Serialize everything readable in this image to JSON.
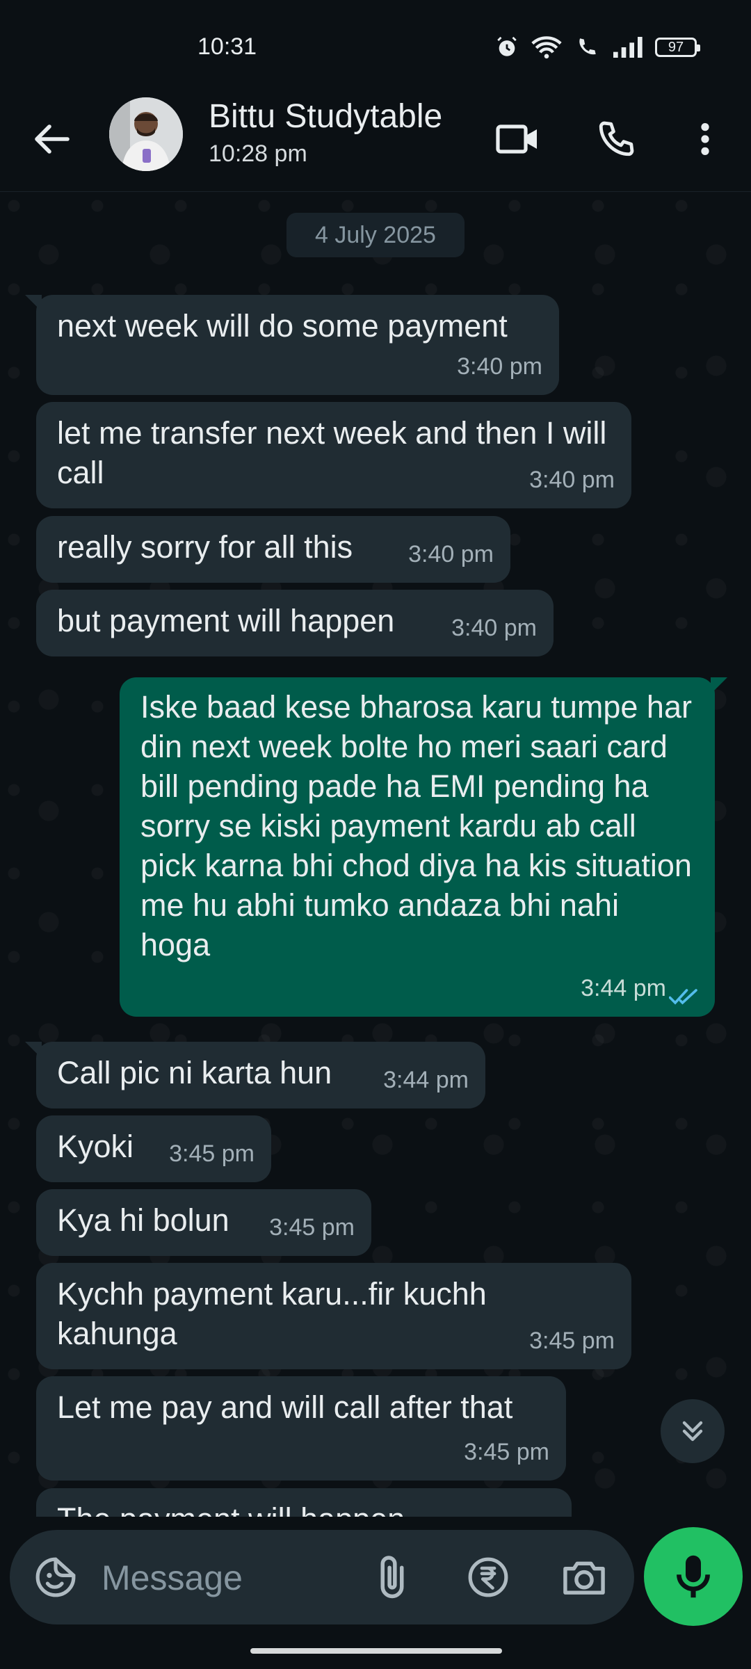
{
  "status_bar": {
    "time": "10:31",
    "battery": "97"
  },
  "header": {
    "contact_name": "Bittu Studytable",
    "last_seen": "10:28 pm",
    "icons": [
      "back-arrow-icon",
      "video-call-icon",
      "voice-call-icon",
      "more-options-icon"
    ]
  },
  "chat": {
    "date_chip": "4 July 2025",
    "messages": [
      {
        "dir": "in",
        "text": "next week will do some payment",
        "time": "3:40 pm"
      },
      {
        "dir": "in",
        "text": "let me transfer next week and then I will call",
        "time": "3:40 pm"
      },
      {
        "dir": "in",
        "text": "really sorry for all this",
        "time": "3:40 pm"
      },
      {
        "dir": "in",
        "text": "but payment will happen",
        "time": "3:40 pm"
      },
      {
        "dir": "out",
        "text": "Iske baad kese bharosa karu tumpe har din next week bolte ho meri saari card bill pending pade ha EMI pending ha sorry se kiski payment kardu ab call pick karna bhi chod diya ha kis situation me hu abhi tumko andaza bhi nahi hoga",
        "time": "3:44 pm",
        "status": "read"
      },
      {
        "dir": "in",
        "text": "Call pic ni karta hun",
        "time": "3:44 pm"
      },
      {
        "dir": "in",
        "text": "Kyoki",
        "time": "3:45 pm"
      },
      {
        "dir": "in",
        "text": "Kya hi bolun",
        "time": "3:45 pm"
      },
      {
        "dir": "in",
        "text": "Kychh payment karu...fir kuchh kahunga",
        "time": "3:45 pm"
      },
      {
        "dir": "in",
        "text": "Let me pay and will call after that",
        "time": "3:45 pm"
      },
      {
        "dir": "in",
        "text": "The payment will happen",
        "time": ""
      }
    ]
  },
  "composer": {
    "placeholder": "Message",
    "icons": [
      "sticker-icon",
      "attach-icon",
      "rupee-payment-icon",
      "camera-icon",
      "mic-icon"
    ]
  },
  "colors": {
    "incoming": "#202c33",
    "outgoing": "#005c4b",
    "accent": "#21c063",
    "read_ticks": "#53bdeb"
  }
}
